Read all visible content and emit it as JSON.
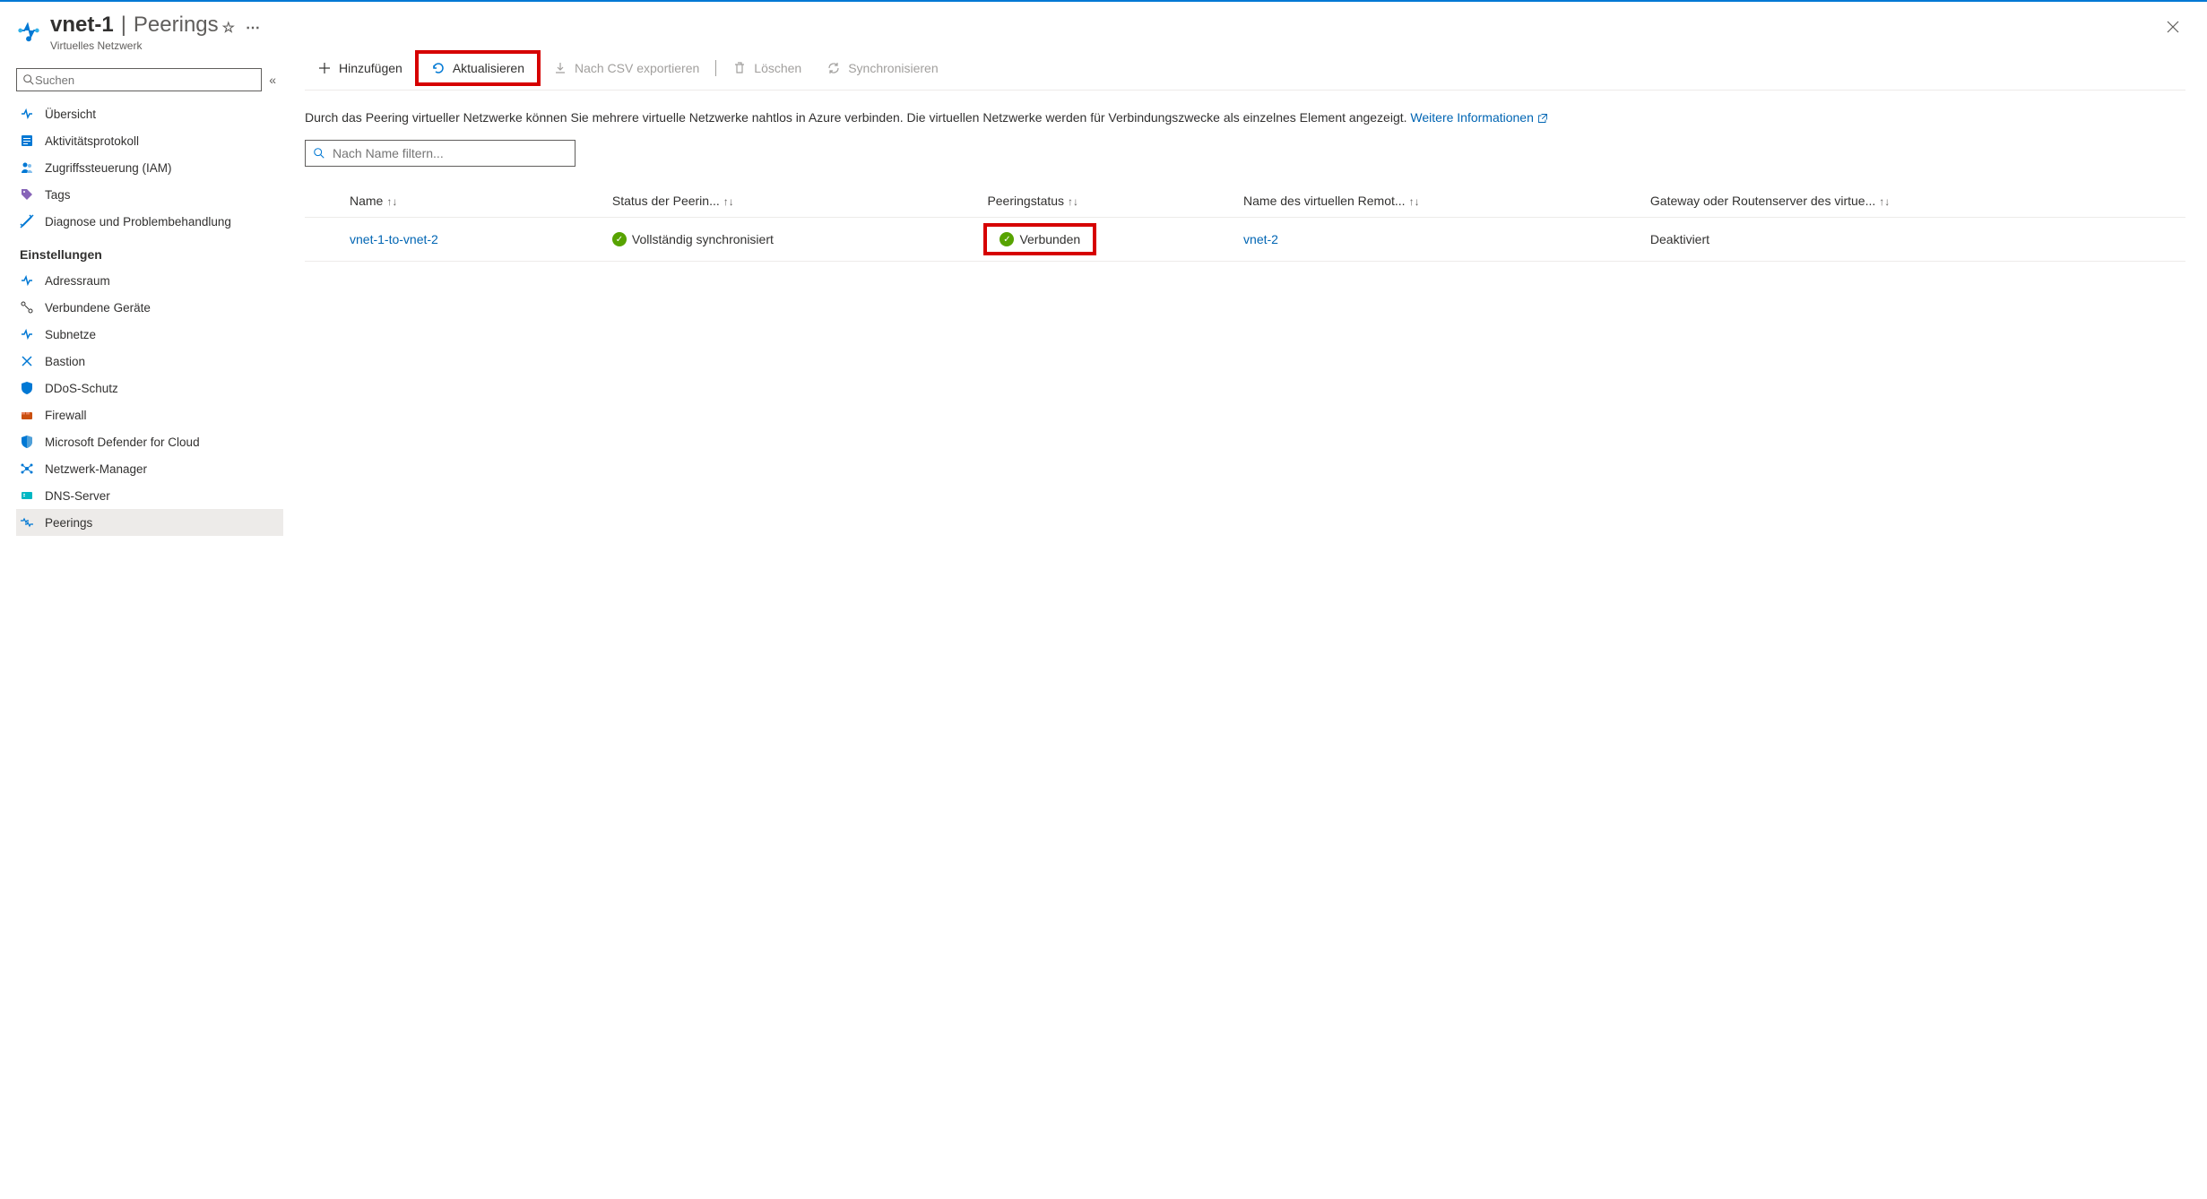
{
  "header": {
    "resource_name": "vnet-1",
    "page_name": "Peerings",
    "subtitle": "Virtuelles Netzwerk"
  },
  "search": {
    "placeholder": "Suchen"
  },
  "nav": {
    "items_top": [
      {
        "label": "Übersicht"
      },
      {
        "label": "Aktivitätsprotokoll"
      },
      {
        "label": "Zugriffssteuerung (IAM)"
      },
      {
        "label": "Tags"
      },
      {
        "label": "Diagnose und Problembehandlung"
      }
    ],
    "section": "Einstellungen",
    "items_settings": [
      {
        "label": "Adressraum"
      },
      {
        "label": "Verbundene Geräte"
      },
      {
        "label": "Subnetze"
      },
      {
        "label": "Bastion"
      },
      {
        "label": "DDoS-Schutz"
      },
      {
        "label": "Firewall"
      },
      {
        "label": "Microsoft Defender for Cloud"
      },
      {
        "label": "Netzwerk-Manager"
      },
      {
        "label": "DNS-Server"
      },
      {
        "label": "Peerings"
      }
    ]
  },
  "toolbar": {
    "add": "Hinzufügen",
    "refresh": "Aktualisieren",
    "export_csv": "Nach CSV exportieren",
    "delete": "Löschen",
    "sync": "Synchronisieren"
  },
  "info": {
    "text": "Durch das Peering virtueller Netzwerke können Sie mehrere virtuelle Netzwerke nahtlos in Azure verbinden. Die virtuellen Netzwerke werden für Verbindungszwecke als einzelnes Element angezeigt.",
    "link": "Weitere Informationen"
  },
  "filter": {
    "placeholder": "Nach Name filtern..."
  },
  "table": {
    "headers": {
      "name": "Name",
      "sync_status": "Status der Peerin...",
      "peering_status": "Peeringstatus",
      "remote_vnet": "Name des virtuellen Remot...",
      "gateway": "Gateway oder Routenserver des virtue..."
    },
    "rows": [
      {
        "name": "vnet-1-to-vnet-2",
        "sync_status": "Vollständig synchronisiert",
        "peering_status": "Verbunden",
        "remote_vnet": "vnet-2",
        "gateway": "Deaktiviert"
      }
    ]
  }
}
